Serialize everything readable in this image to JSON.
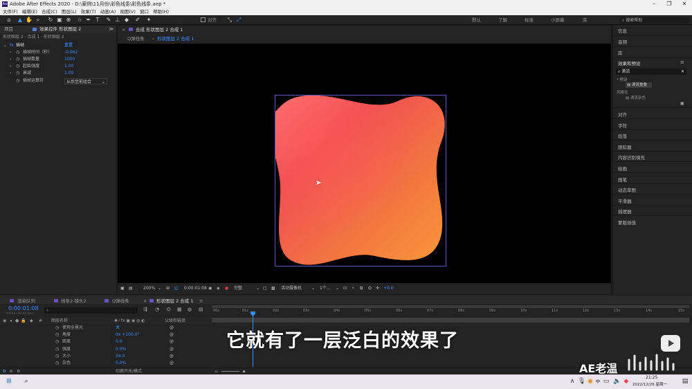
{
  "window": {
    "title": "Adobe After Effects 2020 - D:\\案例\\11月份\\彩色线条\\彩色线条.aep *",
    "app_icon": "Ae"
  },
  "menu": [
    "文件(F)",
    "编辑(E)",
    "合成(C)",
    "图层(L)",
    "效果(T)",
    "动画(A)",
    "视图(V)",
    "窗口",
    "帮助(H)"
  ],
  "toolbar": {
    "align_label": "对齐",
    "workspaces": [
      "默认",
      "了解",
      "标准",
      "小屏幕",
      "库"
    ],
    "search_placeholder": "搜索帮助"
  },
  "project_panel": {
    "tab_project": "项目",
    "tab_effects": "效果控件 形状图层 2",
    "layer_path": "形状图层 2 · 合成 1 · 形状图层 2"
  },
  "effect_controls": {
    "effect_name": "插帧",
    "reset_label": "重置",
    "rows": [
      {
        "label": "插帧时间（秒）",
        "value": "-0.062"
      },
      {
        "label": "插帧数量",
        "value": "1000"
      },
      {
        "label": "起始强度",
        "value": "1.00"
      },
      {
        "label": "衰减",
        "value": "1.00"
      },
      {
        "label": "插帧运算符",
        "value": "从后至前组合"
      }
    ]
  },
  "composition": {
    "tab_label": "合成 形状图层 2 合成 1",
    "breadcrumb_1": "Q弹线条",
    "breadcrumb_2": "形状图层 2 合成 1"
  },
  "comp_footer": {
    "zoom": "200%",
    "timecode": "0:00:01:08",
    "resolution": "完整",
    "camera": "活动摄像机",
    "views": "1个...",
    "exposure": "+0.0"
  },
  "right_panel": {
    "items_top": [
      "信息",
      "音频",
      "库"
    ],
    "effects_title": "效果和预设",
    "search_value": "滴流",
    "tree": [
      "* 预设",
      "滴流重叠",
      "风格化",
      "滴流杂色"
    ],
    "items_bottom": [
      "对齐",
      "字符",
      "段落",
      "跟踪器",
      "内容识别填充",
      "绘画",
      "画笔",
      "动态草图",
      "平滑器",
      "摇摆器",
      "蒙版插值"
    ]
  },
  "timeline": {
    "tabs": [
      "渲染队列",
      "线条2-镜头2",
      "Q弹线条",
      "形状图层 2 合成 1"
    ],
    "timecode": "0:00:01:08",
    "timecode_sub": "00038 (30.00 fps)",
    "col_layer_name": "图层名称",
    "col_parent": "父级和链接",
    "ruler": [
      "00s",
      "01s",
      "02s",
      "03s",
      "04s",
      "05s",
      "06s",
      "07s",
      "08s",
      "09s",
      "10s",
      "11s",
      "12s",
      "13s",
      "14s",
      "15s"
    ],
    "rows": [
      {
        "name": "使用全景光",
        "value": "关"
      },
      {
        "name": "角度",
        "value": "0x +100.0°"
      },
      {
        "name": "距离",
        "value": "0.0"
      },
      {
        "name": "强度",
        "value": "0.0%"
      },
      {
        "name": "大小",
        "value": "34.0"
      },
      {
        "name": "杂色",
        "value": "0.0%"
      }
    ],
    "footer": "切换开关/模式"
  },
  "subtitle": "它就有了一层泛白的效果了",
  "watermark": "AE老温",
  "taskbar": {
    "time": "21:25",
    "date": "2022/12/26 星期一",
    "ime": "中"
  },
  "colors": {
    "accent": "#3a8fff",
    "shape_red": "#ef4e52",
    "shape_orange": "#f58e3a",
    "selection": "#5a5ab4"
  }
}
